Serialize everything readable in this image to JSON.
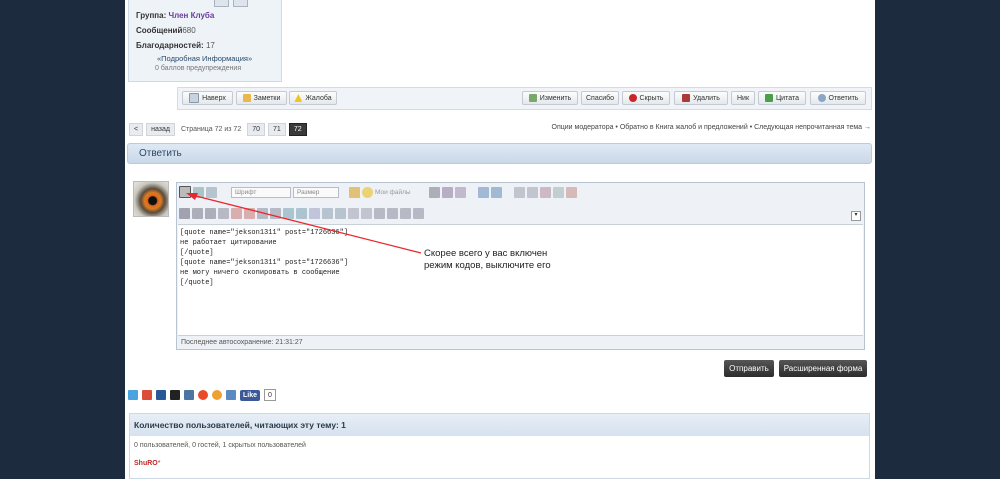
{
  "profile": {
    "group_label": "Группа:",
    "group_value": "Член Клуба",
    "posts_label": "Сообщений",
    "posts_value": "680",
    "thanks_label": "Благодарностей:",
    "thanks_value": "17",
    "more_info": "«Подробная Информация»",
    "warnings": "0 баллов предупреждения"
  },
  "postbar": {
    "top": "Наверх",
    "notes": "Заметки",
    "complaint": "Жалоба",
    "edit": "Изменить",
    "thanks": "Спасибо",
    "hide": "Скрыть",
    "delete": "Удалить",
    "nick": "Ник",
    "quote": "Цитата",
    "reply": "Ответить"
  },
  "pagination": {
    "back_arrow": "<",
    "back": "назад",
    "page_info": "Страница 72 из 72",
    "pages": [
      "70",
      "71",
      "72"
    ],
    "current": "72"
  },
  "mod_links": "Опции модератора • Обратно в Книга жалоб и предложений • Следующая непрочитанная тема →",
  "reply_header": "Ответить",
  "editor": {
    "font_placeholder": "Шрифт",
    "size_placeholder": "Размер",
    "files_label": "Мои файлы",
    "content": "[quote name=\"jekson1311\" post=\"1726636\"]\nне работает цитирование\n[/quote]\n[quote name=\"jekson1311\" post=\"1726636\"]\nне могу ничего скопировать в сообщение\n[/quote]",
    "autosave": "Последнее автосохранение: 21:31:27"
  },
  "annotation": {
    "line1": "Скорее всего у вас включен",
    "line2": "режим кодов, выключите его"
  },
  "buttons": {
    "send": "Отправить",
    "advanced": "Расширенная форма"
  },
  "social": {
    "fb_like": "Like",
    "fb_count": "0"
  },
  "readers": {
    "title": "Количество пользователей, читающих эту тему: 1",
    "counts": "0 пользователей, 0 гостей, 1 скрытых пользователей",
    "user": "ShuRO"
  },
  "colors": {
    "background": "#1c2b3d",
    "accent": "#2a4a6a",
    "arrow": "#e8282e"
  }
}
